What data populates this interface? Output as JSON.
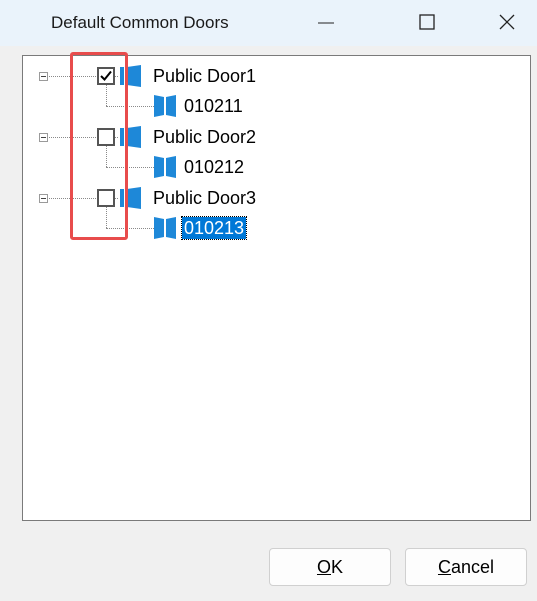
{
  "window": {
    "title": "Default Common Doors"
  },
  "tree": {
    "nodes": [
      {
        "label": "Public Door1",
        "checked": true,
        "children": [
          {
            "label": "010211",
            "selected": false
          }
        ]
      },
      {
        "label": "Public Door2",
        "checked": false,
        "children": [
          {
            "label": "010212",
            "selected": false
          }
        ]
      },
      {
        "label": "Public Door3",
        "checked": false,
        "children": [
          {
            "label": "010213",
            "selected": true
          }
        ]
      }
    ]
  },
  "buttons": {
    "ok_mnemonic": "O",
    "ok_rest": "K",
    "cancel_mnemonic": "C",
    "cancel_rest": "ancel"
  },
  "colors": {
    "door_icon": "#1e88d8",
    "selection": "#0078d7",
    "highlight_box": "#e84c4c"
  }
}
